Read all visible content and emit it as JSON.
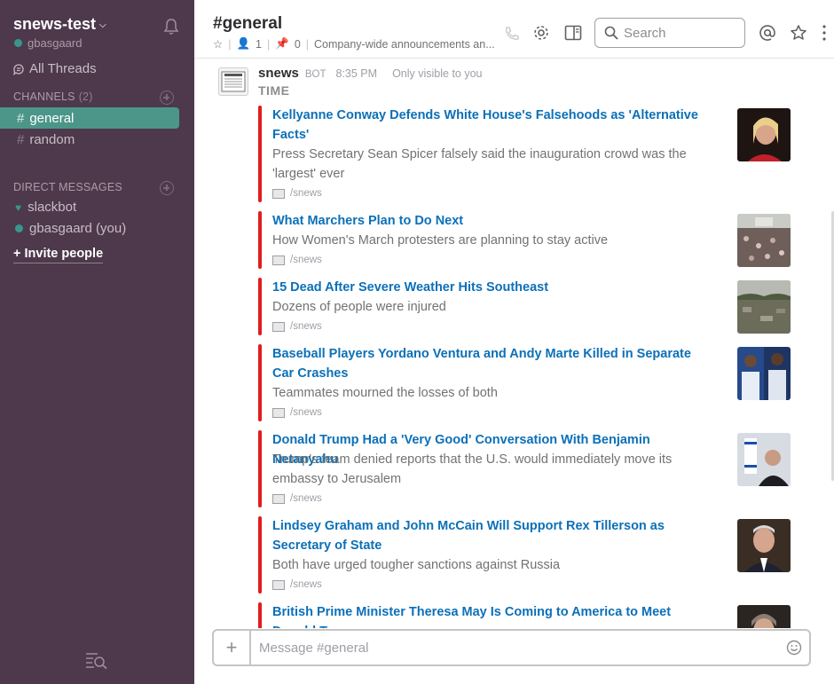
{
  "sidebar": {
    "team_name": "snews-test",
    "user": "gbasgaard",
    "all_threads": "All Threads",
    "channels_header": "CHANNELS",
    "channels_count": "(2)",
    "channels": [
      "general",
      "random"
    ],
    "dm_header": "DIRECT MESSAGES",
    "dms": [
      "slackbot",
      "gbasgaard (you)"
    ],
    "invite": "Invite people"
  },
  "header": {
    "channel": "#general",
    "members": "1",
    "pins": "0",
    "topic": "Company-wide announcements an...",
    "search_placeholder": "Search"
  },
  "message": {
    "sender": "snews",
    "badge": "BOT",
    "time": "8:35 PM",
    "visibility": "Only visible to you",
    "source": "TIME"
  },
  "articles": [
    {
      "title": "Kellyanne Conway Defends White House's Falsehoods as 'Alternative Facts'",
      "desc": "Press Secretary Sean Spicer falsely said the inauguration crowd was the 'largest' ever",
      "footer": "/snews"
    },
    {
      "title": "What Marchers Plan to Do Next",
      "desc": "How Women's March protesters are planning to stay active",
      "footer": "/snews"
    },
    {
      "title": "15 Dead After Severe Weather Hits Southeast",
      "desc": "Dozens of people were injured",
      "footer": "/snews"
    },
    {
      "title": "Baseball Players Yordano Ventura and Andy Marte Killed in Separate Car Crashes",
      "desc": "Teammates mourned the losses of both",
      "footer": "/snews"
    },
    {
      "title": "Donald Trump Had a 'Very Good' Conversation With Benjamin Netanyahu",
      "desc": "Trump's team denied reports that the U.S. would immediately move its embassy to Jerusalem",
      "footer": "/snews"
    },
    {
      "title": "Lindsey Graham and John McCain Will Support Rex Tillerson as Secretary of State",
      "desc": "Both have urged tougher sanctions against Russia",
      "footer": "/snews"
    },
    {
      "title": "British Prime Minister Theresa May Is Coming to America to Meet Donald T",
      "desc": "",
      "footer": ""
    }
  ],
  "composer": {
    "placeholder": "Message #general"
  },
  "colors": {
    "sidebar_bg": "#4d394b",
    "active_channel": "#4c9689",
    "attachment_bar": "#e01e1e",
    "link": "#0b70b8"
  }
}
